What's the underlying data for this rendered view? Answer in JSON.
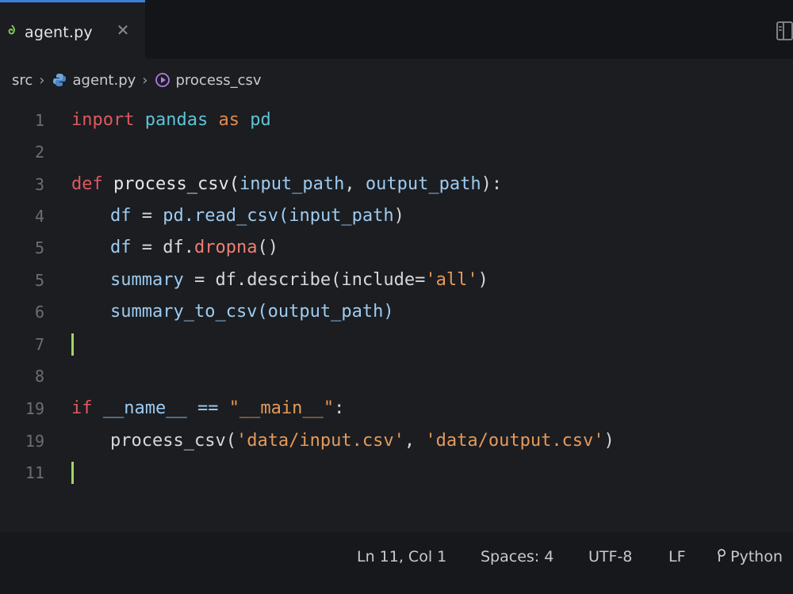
{
  "tab": {
    "file_name": "agent.py",
    "close_glyph": "✕"
  },
  "breadcrumb": {
    "folder": "src",
    "file": "agent.py",
    "symbol": "process_csv"
  },
  "gutter": {
    "line_numbers": [
      "1",
      "2",
      "3",
      "4",
      "5",
      "5",
      "6",
      "7",
      "8",
      "19",
      "19",
      "11"
    ]
  },
  "code": {
    "l1": {
      "kw": "inport",
      "mod": "pandas",
      "as": "as",
      "alias": "pd"
    },
    "l3": {
      "kw": "def",
      "fn": "process_csv(",
      "p1": "input_path",
      "comma": ", ",
      "p2": "output_path",
      "end": "):"
    },
    "l4": {
      "v": "df",
      "eq": " = ",
      "a": "pd.read_csv(",
      "b": "input_path",
      "c": ")"
    },
    "l5": {
      "v": "df",
      "eq": " = ",
      "a": "df.",
      "b": "dropna",
      "c": "()"
    },
    "l6": {
      "v": "summary",
      "eq": " = ",
      "a": "df.describe(include=",
      "s": "'all'",
      "c": ")"
    },
    "l7": {
      "a": "summary_to_csv(output_path)"
    },
    "l10": {
      "kw": "if",
      "a": " __name__ == ",
      "s": "\"__main__\"",
      "c": ":"
    },
    "l11": {
      "a": "process_csv(",
      "s1": "'data/input.csv'",
      "comma": ", ",
      "s2": "'data/output.csv'",
      "c": ")"
    }
  },
  "status": {
    "position": "Ln 11, Col 1",
    "indent": "Spaces: 4",
    "encoding": "UTF-8",
    "eol": "LF",
    "language": "Python"
  },
  "colors": {
    "background": "#1b1d21",
    "tab_accent": "#3b82d6",
    "cursor": "#a6d468",
    "keyword": "#e0585f",
    "string": "#e59a5a"
  },
  "icons": {
    "tab_file": "python-file-icon",
    "split": "split-editor-icon",
    "breadcrumb_file": "python-file-icon",
    "breadcrumb_symbol": "function-symbol-icon",
    "language": "language-mode-icon"
  }
}
